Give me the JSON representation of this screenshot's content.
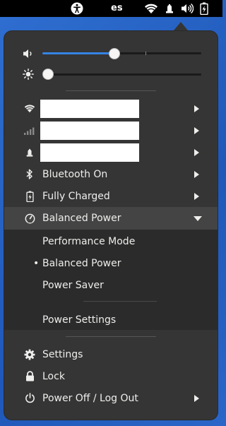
{
  "topbar": {
    "accessibility_icon": "accessibility-icon",
    "language": "es",
    "status_icons": [
      "wifi-icon",
      "vpn-icon",
      "volume-icon",
      "battery-icon"
    ]
  },
  "sliders": {
    "volume": {
      "icon": "volume-low-icon",
      "value": 0.45
    },
    "brightness": {
      "icon": "brightness-icon",
      "value": 0.0
    }
  },
  "connections": {
    "wifi_icon": "wifi-icon",
    "mobile_icon": "cellular-icon",
    "vpn_icon": "vpn-icon"
  },
  "items": {
    "bluetooth": "Bluetooth On",
    "battery": "Fully Charged",
    "power_mode": "Balanced Power"
  },
  "power_modes": {
    "performance": "Performance Mode",
    "balanced": "Balanced Power",
    "saver": "Power Saver",
    "selected_marker": "•",
    "settings": "Power Settings"
  },
  "bottom": {
    "settings": "Settings",
    "lock": "Lock",
    "power": "Power Off / Log Out"
  },
  "colors": {
    "accent": "#3584e4",
    "menu_bg": "#353535",
    "submenu_bg": "#2b2b2b",
    "text": "#eeeeec"
  }
}
